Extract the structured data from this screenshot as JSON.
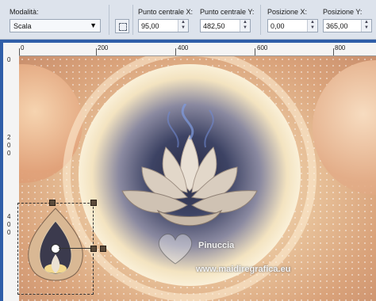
{
  "toolbar": {
    "mode_label": "Modalità:",
    "mode_value": "Scala",
    "center_x_label": "Punto centrale X:",
    "center_x_value": "95,00",
    "center_y_label": "Punto centrale Y:",
    "center_y_value": "482,50",
    "pos_x_label": "Posizione X:",
    "pos_x_value": "0,00",
    "pos_y_label": "Posizione Y:",
    "pos_y_value": "365,00"
  },
  "ruler": {
    "top_labels": [
      "0",
      "200",
      "400",
      "600",
      "800"
    ],
    "left_labels": [
      [
        "0"
      ],
      [
        "2",
        "0",
        "0"
      ],
      [
        "4",
        "0",
        "0"
      ]
    ]
  },
  "watermark": {
    "name": "Pinuccia",
    "site": "www.maidiregrafica.eu"
  },
  "colors": {
    "toolbar_bg": "#dde3ec",
    "frame_blue": "#2f5ea8",
    "handle": "#5b4b3b"
  },
  "icons": {
    "transform_tool": "pick-tool-icon",
    "dropdown": "chevron-down-icon",
    "spin": "spin-arrows-icon"
  }
}
